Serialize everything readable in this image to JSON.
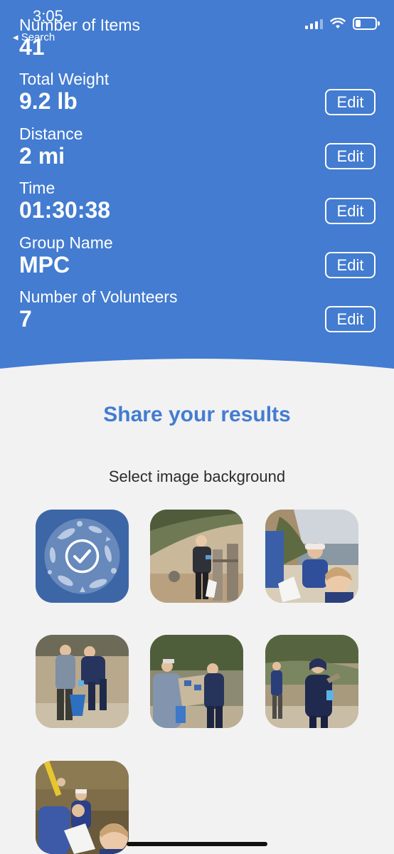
{
  "status_bar": {
    "time": "3:05",
    "back_label": "◂ Search"
  },
  "stats": [
    {
      "label": "Number of Items",
      "value": "41"
    },
    {
      "label": "Total Weight",
      "value": "9.2 lb",
      "edit": "Edit"
    },
    {
      "label": "Distance",
      "value": "2 mi",
      "edit": "Edit"
    },
    {
      "label": "Time",
      "value": "01:30:38",
      "edit": "Edit"
    },
    {
      "label": "Group Name",
      "value": "MPC",
      "edit": "Edit"
    },
    {
      "label": "Number of Volunteers",
      "value": "7",
      "edit": "Edit"
    }
  ],
  "share": {
    "title": "Share your results",
    "subtitle": "Select image background",
    "backgrounds": [
      {
        "name": "ocean-pattern",
        "selected": true,
        "icon": "checkmark-icon"
      },
      {
        "name": "volunteer-photo-beach-fence",
        "selected": false
      },
      {
        "name": "volunteer-photo-selfie-shoreline",
        "selected": false
      },
      {
        "name": "volunteer-photo-bucket",
        "selected": false
      },
      {
        "name": "volunteer-photo-sign",
        "selected": false
      },
      {
        "name": "volunteer-photo-dune",
        "selected": false
      },
      {
        "name": "volunteer-photo-group-selfie",
        "selected": false
      }
    ]
  },
  "colors": {
    "header": "#437cd0",
    "accent": "#437cd0",
    "background": "#f2f2f3",
    "selected_tile": "#3d66a6"
  }
}
